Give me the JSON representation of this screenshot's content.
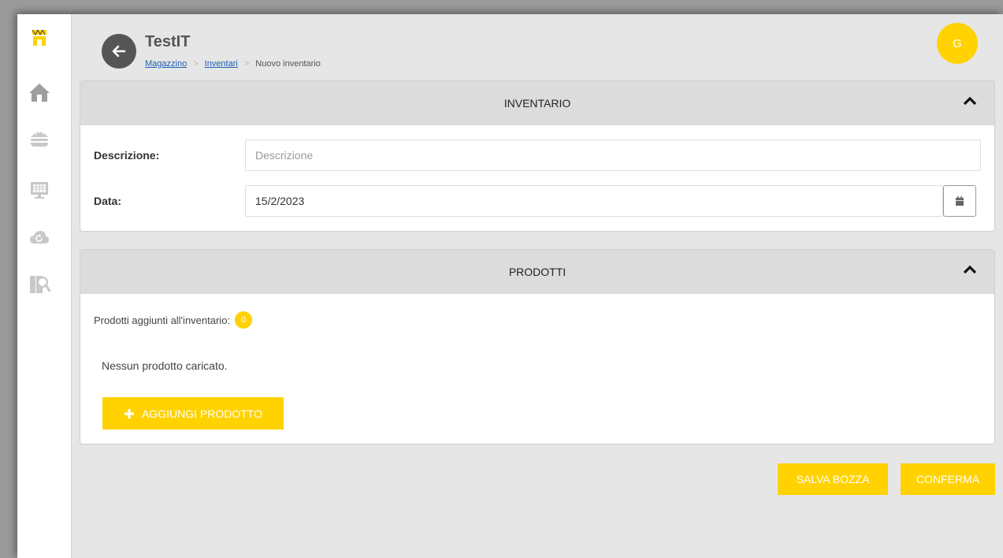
{
  "app": {
    "title": "TestIT"
  },
  "breadcrumb": {
    "items": [
      "Magazzino",
      "Inventari"
    ],
    "current": "Nuovo inventario"
  },
  "user": {
    "initial": "G"
  },
  "sidebar": {
    "icons": [
      "store-icon",
      "home-icon",
      "burger-icon",
      "pos-terminal-icon",
      "cloud-sync-icon",
      "inventory-search-icon"
    ]
  },
  "inventario": {
    "heading": "INVENTARIO",
    "descrizione_label": "Descrizione:",
    "descrizione_value": "",
    "descrizione_placeholder": "Descrizione",
    "data_label": "Data:",
    "data_value": "15/2/2023"
  },
  "prodotti": {
    "heading": "PRODOTTI",
    "count_label": "Prodotti aggiunti all'inventario:",
    "count": "0",
    "empty_message": "Nessun prodotto caricato.",
    "add_button": "AGGIUNGI PRODOTTO"
  },
  "actions": {
    "save_draft": "SALVA BOZZA",
    "confirm": "CONFERMA"
  },
  "colors": {
    "accent": "#ffd200",
    "header_bg": "#dcdcdc",
    "page_bg": "#e6e6e6"
  }
}
